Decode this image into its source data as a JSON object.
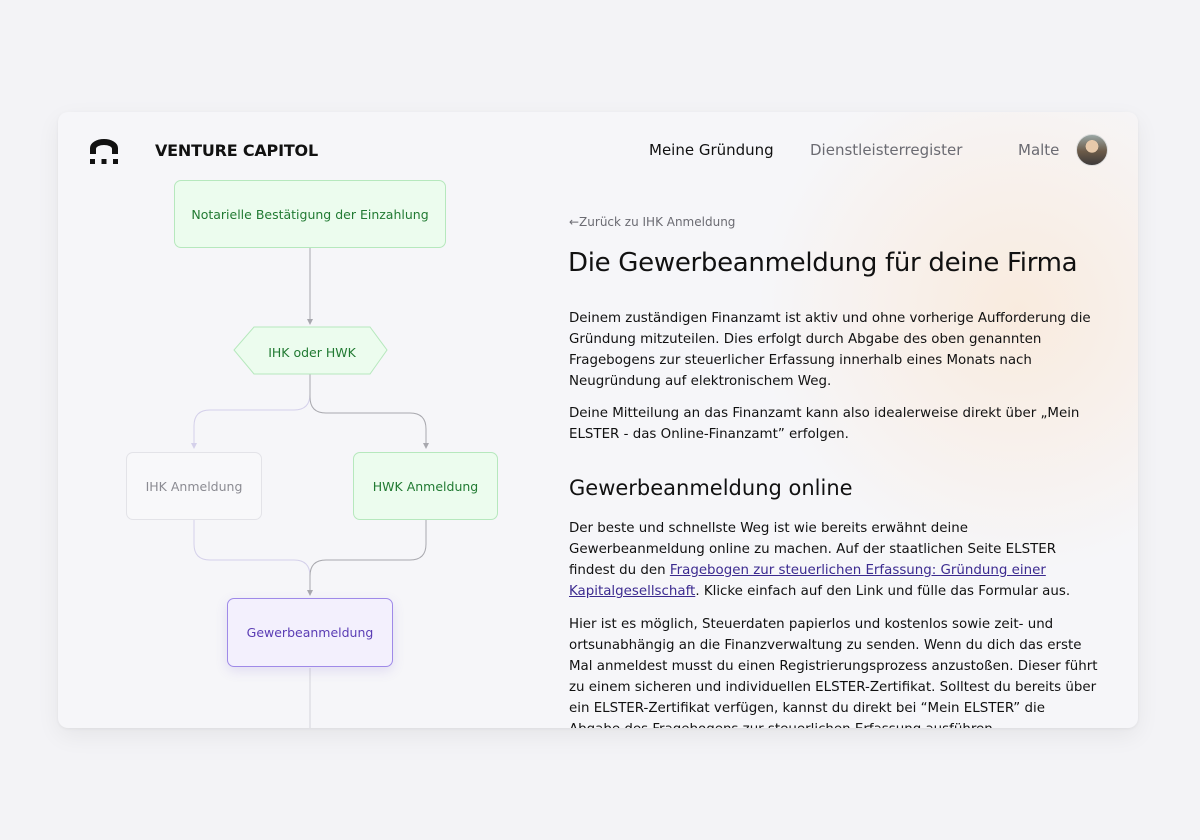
{
  "header": {
    "brand": "VENTURE CAPITOL",
    "nav": [
      "Meine Gründung",
      "Dienstleisterregister"
    ],
    "user_name": "Malte",
    "logo_icon": "arch-dots-logo",
    "avatar_icon": "user-avatar"
  },
  "flow": {
    "node_top": "Notarielle Bestätigung der Einzahlung",
    "decision": "IHK oder HWK",
    "branch_left": "IHK Anmeldung",
    "branch_right": "HWK Anmeldung",
    "node_current": "Gewerbeanmeldung"
  },
  "article": {
    "back_link": "←Zurück zu IHK Anmeldung",
    "title": "Die Gewerbeanmeldung für deine Firma",
    "p1": "Deinem zuständigen Finanzamt ist aktiv und ohne vorherige Aufforderung die Gründung mitzuteilen. Dies erfolgt durch Abgabe des oben genannten Fragebogens zur steuerlicher Erfassung innerhalb eines Monats nach Neugründung auf elektronischem Weg.",
    "p2": "Deine Mitteilung an das Finanzamt kann also idealerweise direkt über „Mein ELSTER - das Online-Finanzamt” erfolgen.",
    "section_title": "Gewerbeanmeldung online",
    "p3_before": "Der beste und schnellste Weg ist wie bereits erwähnt deine Gewerbeanmeldung online zu machen. Auf der staatlichen Seite ELSTER findest du den ",
    "p3_link": "Fragebogen zur steuerlichen Erfassung: Gründung einer Kapitalgesellschaft",
    "p3_after": ". Klicke einfach auf den Link und fülle das Formular aus.",
    "p4": "Hier ist es möglich, Steuerdaten papierlos und kostenlos sowie zeit- und ortsunabhängig an die Finanzverwaltung zu senden. Wenn du dich das erste Mal anmeldest musst du einen Registrierungsprozess anzustoßen. Dieser führt zu einem sicheren und individuellen ELSTER-Zertifikat. Solltest du bereits über ein ELSTER-Zertifikat verfügen, kannst du direkt bei “Mein ELSTER” die Abgabe des Fragebogens zur steuerlichen Erfassung ausführen."
  },
  "colors": {
    "green_text": "#217a32",
    "purple_text": "#5a3cb4",
    "link": "#3b2a8f"
  }
}
